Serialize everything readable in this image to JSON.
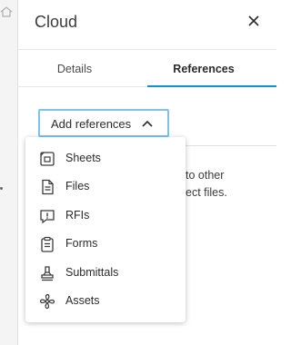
{
  "header": {
    "title": "Cloud",
    "close_icon": "close-icon"
  },
  "tabs": [
    {
      "label": "Details",
      "selected": false
    },
    {
      "label": "References",
      "selected": true
    }
  ],
  "add_references": {
    "label": "Add references",
    "expanded": true
  },
  "empty_state": {
    "line1": "to other",
    "line2": "ect files."
  },
  "menu": {
    "items": [
      {
        "label": "Sheets",
        "icon": "sheets-icon"
      },
      {
        "label": "Files",
        "icon": "file-icon"
      },
      {
        "label": "RFIs",
        "icon": "rfi-icon"
      },
      {
        "label": "Forms",
        "icon": "clipboard-icon"
      },
      {
        "label": "Submittals",
        "icon": "stamp-icon"
      },
      {
        "label": "Assets",
        "icon": "fan-icon"
      }
    ]
  },
  "colors": {
    "accent": "#0696d7",
    "focus_border": "#7fc4e8",
    "text": "#3c3c3c"
  }
}
